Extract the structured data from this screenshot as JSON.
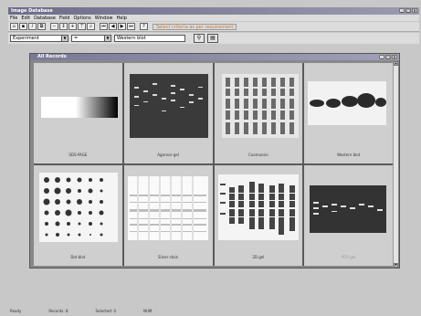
{
  "window": {
    "title": "Image Database"
  },
  "menu": [
    "File",
    "Edit",
    "Database",
    "Field",
    "Options",
    "Window",
    "Help"
  ],
  "toolbar": {
    "criteria_label": "Select criteria as per requirement"
  },
  "search": {
    "field_value": "Experiment",
    "operator_value": "=",
    "query_value": "Western blot"
  },
  "child": {
    "title": "All Records"
  },
  "thumbnails": [
    {
      "label": "SDS-PAGE",
      "kind": "gradient"
    },
    {
      "label": "Agarose gel",
      "kind": "gel"
    },
    {
      "label": "Coomassie",
      "kind": "lanes"
    },
    {
      "label": "Western blot",
      "kind": "western"
    },
    {
      "label": "Dot blot",
      "kind": "dotblot"
    },
    {
      "label": "Silver stain",
      "kind": "silver"
    },
    {
      "label": "2D gel",
      "kind": "bands"
    },
    {
      "label": "PCR gel",
      "kind": "pcr",
      "dim": true
    }
  ],
  "status": [
    "Ready",
    "Records: 8",
    "Selected: 0",
    "NUM"
  ]
}
